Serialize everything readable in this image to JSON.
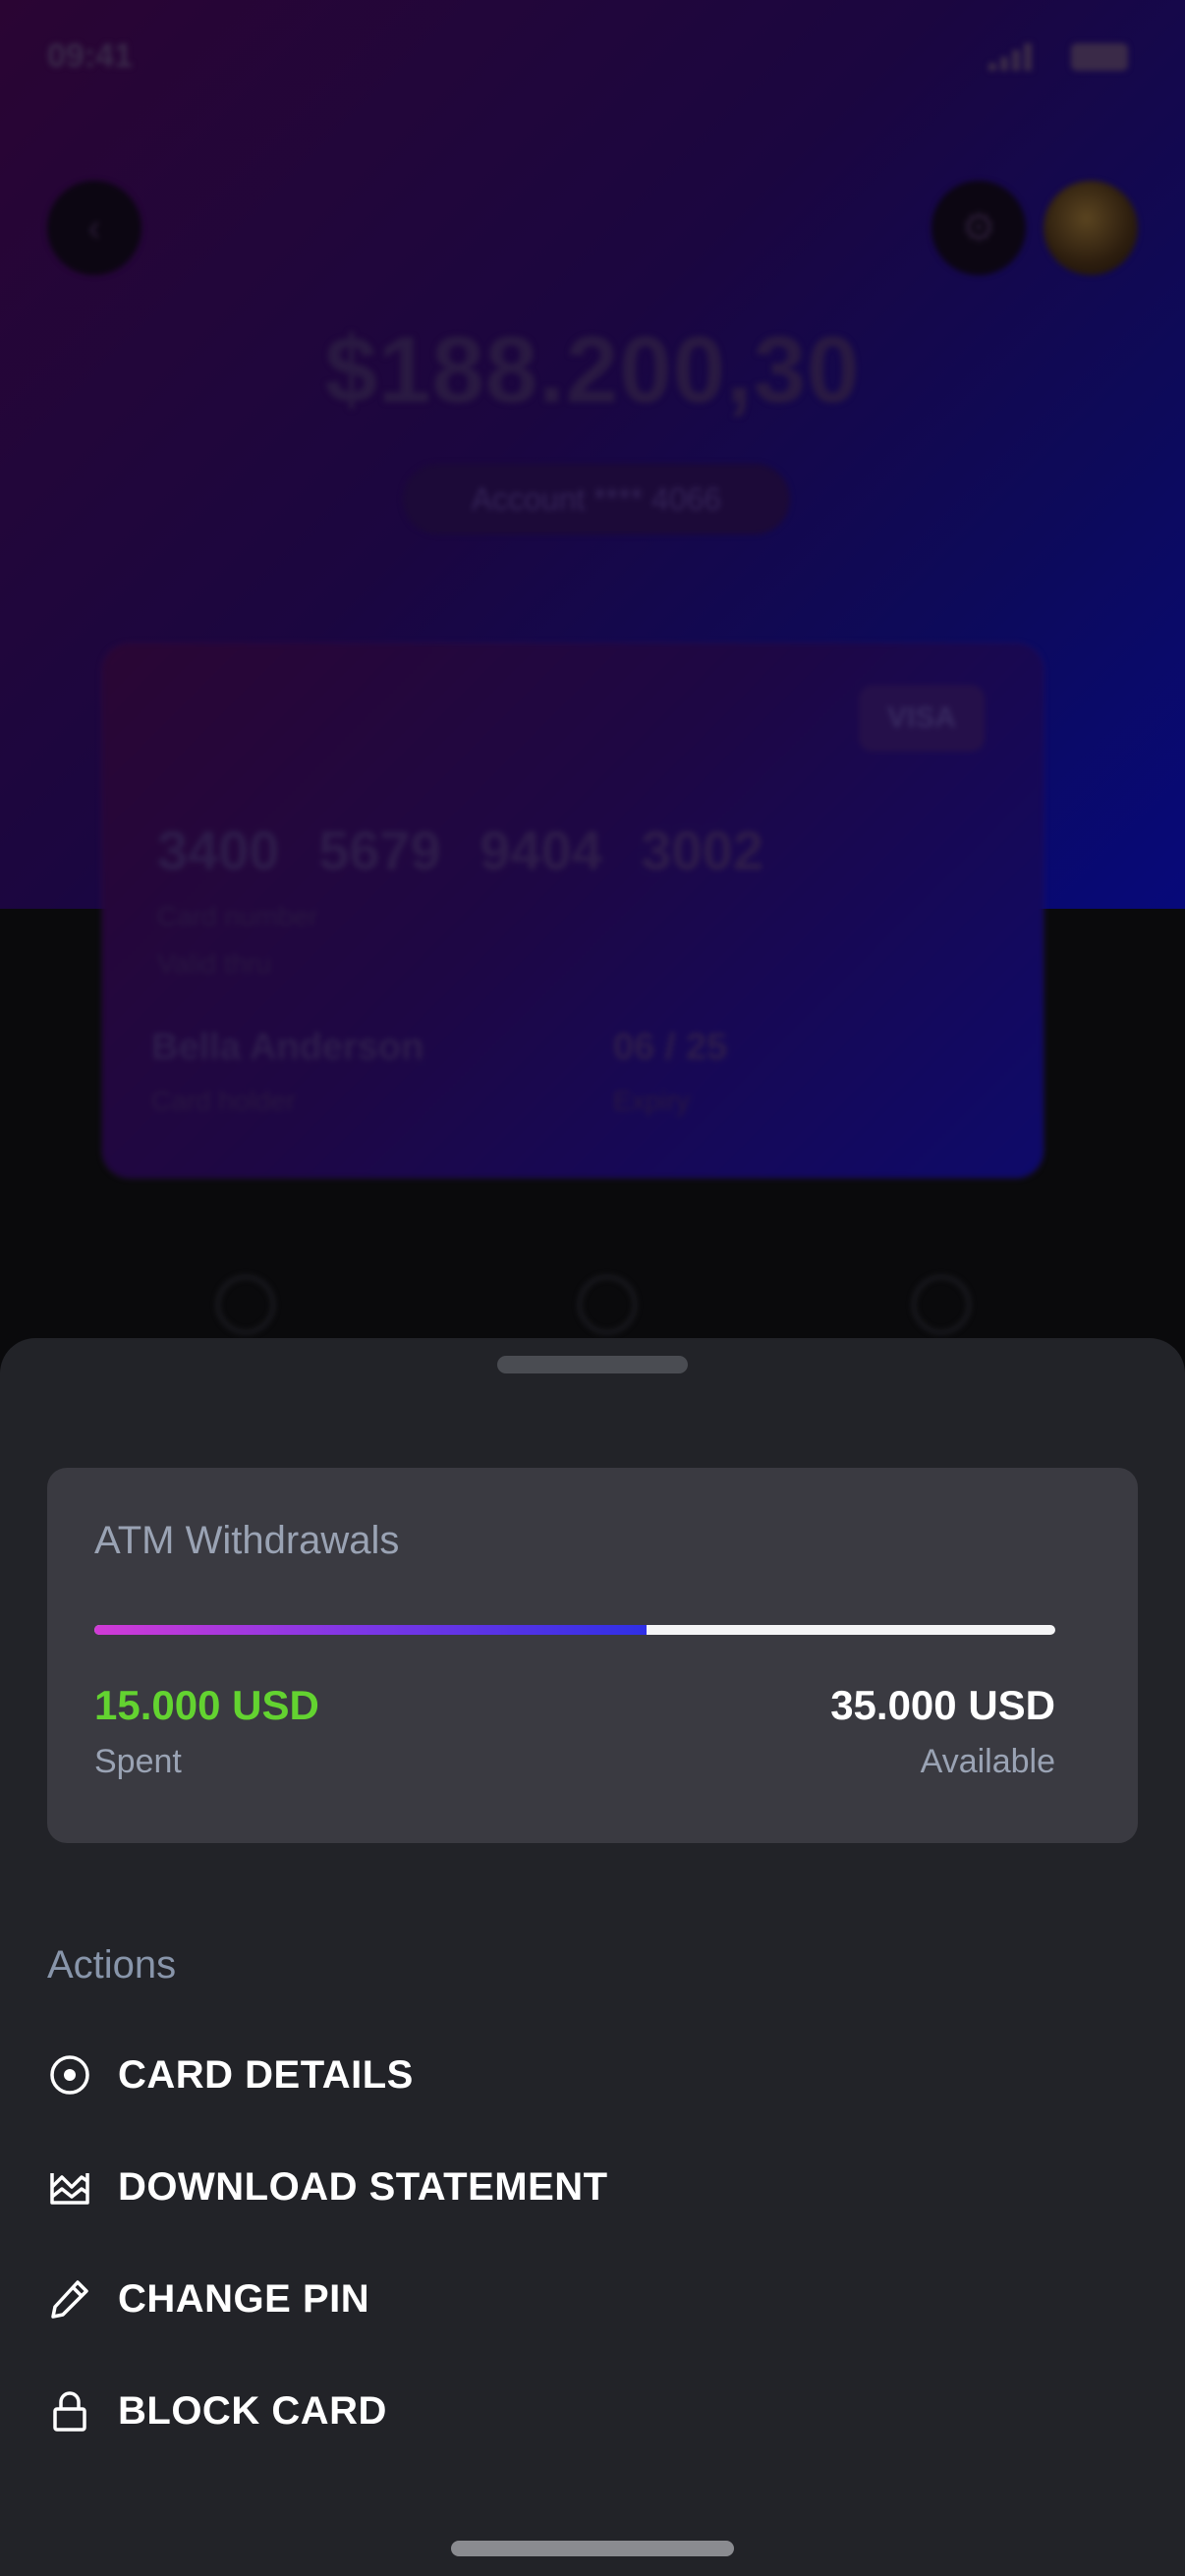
{
  "background": {
    "status_time": "09:41",
    "balance": "$188.200,30",
    "account_label": "Account **** 4066",
    "card": {
      "brand": "VISA",
      "number": "3400 5679 9404 3002",
      "number_caption": "Card number",
      "valid_caption": "Valid thru",
      "holder_name": "Bella Anderson",
      "holder_caption": "Card holder",
      "expiry": "06 / 25",
      "expiry_caption": "Expiry"
    }
  },
  "sheet": {
    "limit": {
      "title": "ATM Withdrawals",
      "spent_value": "15.000 USD",
      "spent_label": "Spent",
      "available_value": "35.000 USD",
      "available_label": "Available",
      "spent_fraction": 0.575
    },
    "actions_heading": "Actions",
    "actions": [
      {
        "label": "CARD DETAILS",
        "icon": "target-icon"
      },
      {
        "label": "DOWNLOAD STATEMENT",
        "icon": "chart-statement-icon"
      },
      {
        "label": "CHANGE PIN",
        "icon": "pencil-icon"
      },
      {
        "label": "BLOCK CARD",
        "icon": "lock-icon"
      }
    ]
  },
  "colors": {
    "sheet_bg": "#222328",
    "limit_card_bg": "#3a3a41",
    "spent_green": "#63d330",
    "progress_start": "#d13ad6",
    "progress_end": "#2f2fe6",
    "muted_text": "#9aa3b4"
  }
}
